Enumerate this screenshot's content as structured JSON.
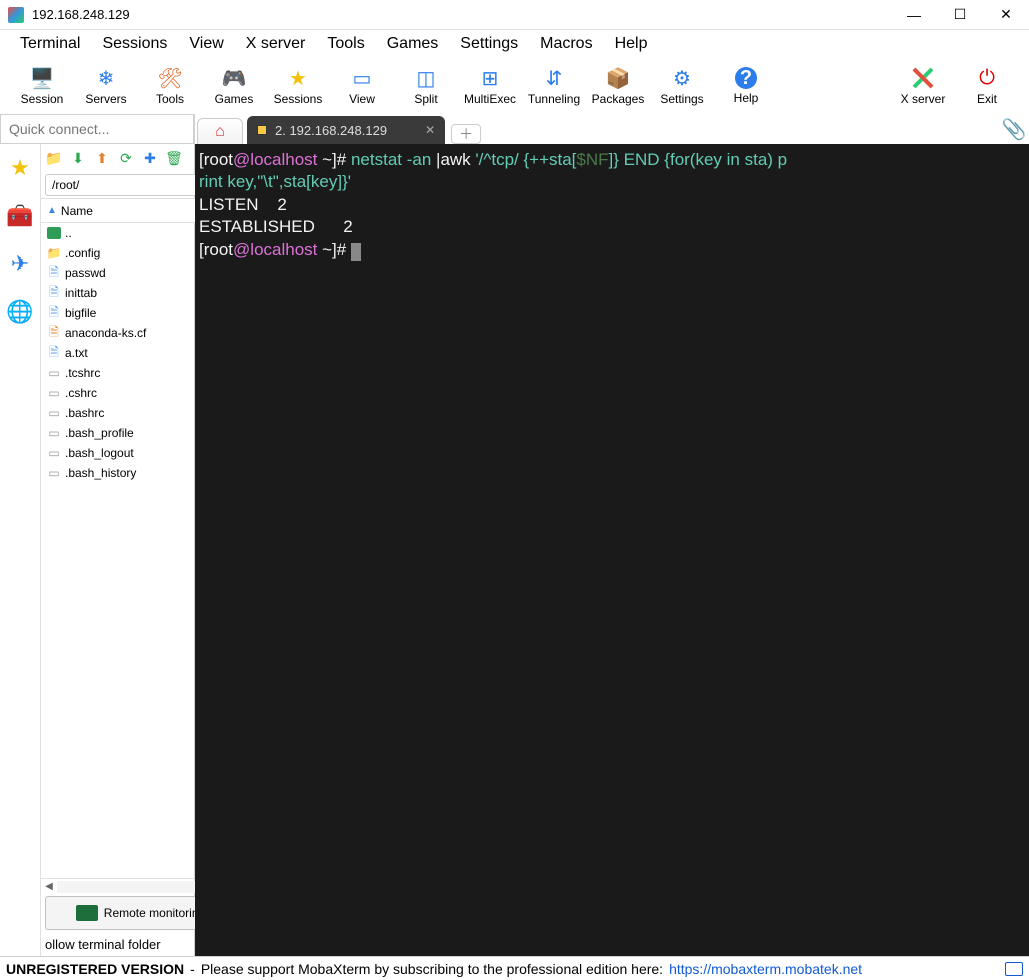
{
  "window": {
    "title": "192.168.248.129",
    "minimize": "—",
    "maximize": "☐",
    "close": "✕"
  },
  "menubar": [
    "Terminal",
    "Sessions",
    "View",
    "X server",
    "Tools",
    "Games",
    "Settings",
    "Macros",
    "Help"
  ],
  "toolbar": [
    {
      "label": "Session",
      "icon": "🖥️"
    },
    {
      "label": "Servers",
      "icon": "⚙"
    },
    {
      "label": "Tools",
      "icon": "🛠"
    },
    {
      "label": "Games",
      "icon": "🎮"
    },
    {
      "label": "Sessions",
      "icon": "⭐"
    },
    {
      "label": "View",
      "icon": "👁"
    },
    {
      "label": "Split",
      "icon": "▥"
    },
    {
      "label": "MultiExec",
      "icon": "⊞"
    },
    {
      "label": "Tunneling",
      "icon": "⇅"
    },
    {
      "label": "Packages",
      "icon": "📦"
    },
    {
      "label": "Settings",
      "icon": "⚙"
    },
    {
      "label": "Help",
      "icon": "?"
    }
  ],
  "toolbar_right": [
    {
      "label": "X server",
      "icon": "X"
    },
    {
      "label": "Exit",
      "icon": "⏻"
    }
  ],
  "quick_connect_placeholder": "Quick connect...",
  "sftp": {
    "path": "/root/",
    "header": "Name",
    "files": [
      {
        "name": "..",
        "type": "parent"
      },
      {
        "name": ".config",
        "type": "folder"
      },
      {
        "name": "passwd",
        "type": "text"
      },
      {
        "name": "inittab",
        "type": "text"
      },
      {
        "name": "bigfile",
        "type": "text"
      },
      {
        "name": "anaconda-ks.cf",
        "type": "script"
      },
      {
        "name": "a.txt",
        "type": "text"
      },
      {
        "name": ".tcshrc",
        "type": "hidden"
      },
      {
        "name": ".cshrc",
        "type": "hidden"
      },
      {
        "name": ".bashrc",
        "type": "hidden"
      },
      {
        "name": ".bash_profile",
        "type": "hidden"
      },
      {
        "name": ".bash_logout",
        "type": "hidden"
      },
      {
        "name": ".bash_history",
        "type": "hidden"
      }
    ],
    "remote_monitoring": "Remote monitoring",
    "follow_text": "ollow terminal folder"
  },
  "tabs": {
    "session_label": "2. 192.168.248.129"
  },
  "terminal": {
    "prompt_user": "root",
    "prompt_at": "@",
    "prompt_host": "localhost",
    "prompt_path": " ~]# ",
    "line1_cmd_a": "netstat ",
    "line1_cmd_b": "-an ",
    "line1_cmd_c": "|awk ",
    "line1_cmd_d": "'/^tcp/ {++sta[",
    "line1_cmd_e": "$NF",
    "line1_cmd_f": "]} END {for(key in sta) p",
    "line2": "rint key,\"\\t\",sta[key]}'",
    "line3": "LISTEN    2",
    "line4": "ESTABLISHED      2",
    "prompt2_open": "[",
    "prompt2_close": ""
  },
  "footer": {
    "unreg": "UNREGISTERED VERSION",
    "dash": " - ",
    "msg": "Please support MobaXterm by subscribing to the professional edition here:",
    "url": "https://mobaxterm.mobatek.net"
  }
}
